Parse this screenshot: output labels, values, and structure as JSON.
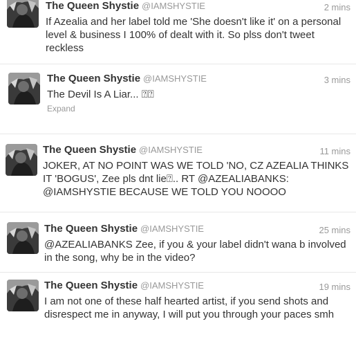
{
  "tweets": [
    {
      "name": "The Queen Shystie",
      "handle": "@IAMSHYSTIE",
      "time": "2 mins",
      "text": "If Azealia and her label told me 'She doesn't like it' on a personal level & business I 100% of dealt with it. So plss don't tweet reckless",
      "avatar_icon": "user-avatar-photo"
    },
    {
      "name": "The Queen Shystie",
      "handle": "@IAMSHYSTIE",
      "time": "3 mins",
      "text": "The Devil Is A Liar... ⍰⍰",
      "expand": "Expand",
      "avatar_icon": "user-avatar-photo"
    },
    {
      "name": "The Queen Shystie",
      "handle": "@IAMSHYSTIE",
      "time": "11 mins",
      "text": "JOKER, AT NO POINT WAS WE TOLD 'NO, CZ AZEALIA THINKS IT 'BOGUS', Zee pls dnt lie⍰.. RT @AZEALIABANKS: @IAMSHYSTIE BECAUSE WE TOLD YOU NOOOO",
      "avatar_icon": "user-avatar-photo"
    },
    {
      "name": "The Queen Shystie",
      "handle": "@IAMSHYSTIE",
      "time": "25 mins",
      "text": "@AZEALIABANKS Zee, if you & your label didn't wana b involved in the song, why be in the video?",
      "avatar_icon": "user-avatar-photo"
    },
    {
      "name": "The Queen Shystie",
      "handle": "@IAMSHYSTIE",
      "time": "19 mins",
      "text": "I am not one of these half hearted artist, if you send shots and disrespect me in anyway, I will put you through your paces smh",
      "avatar_icon": "user-avatar-photo"
    }
  ],
  "colors": {
    "text": "#333333",
    "meta": "#999999",
    "divider": "#e8e8e8"
  }
}
